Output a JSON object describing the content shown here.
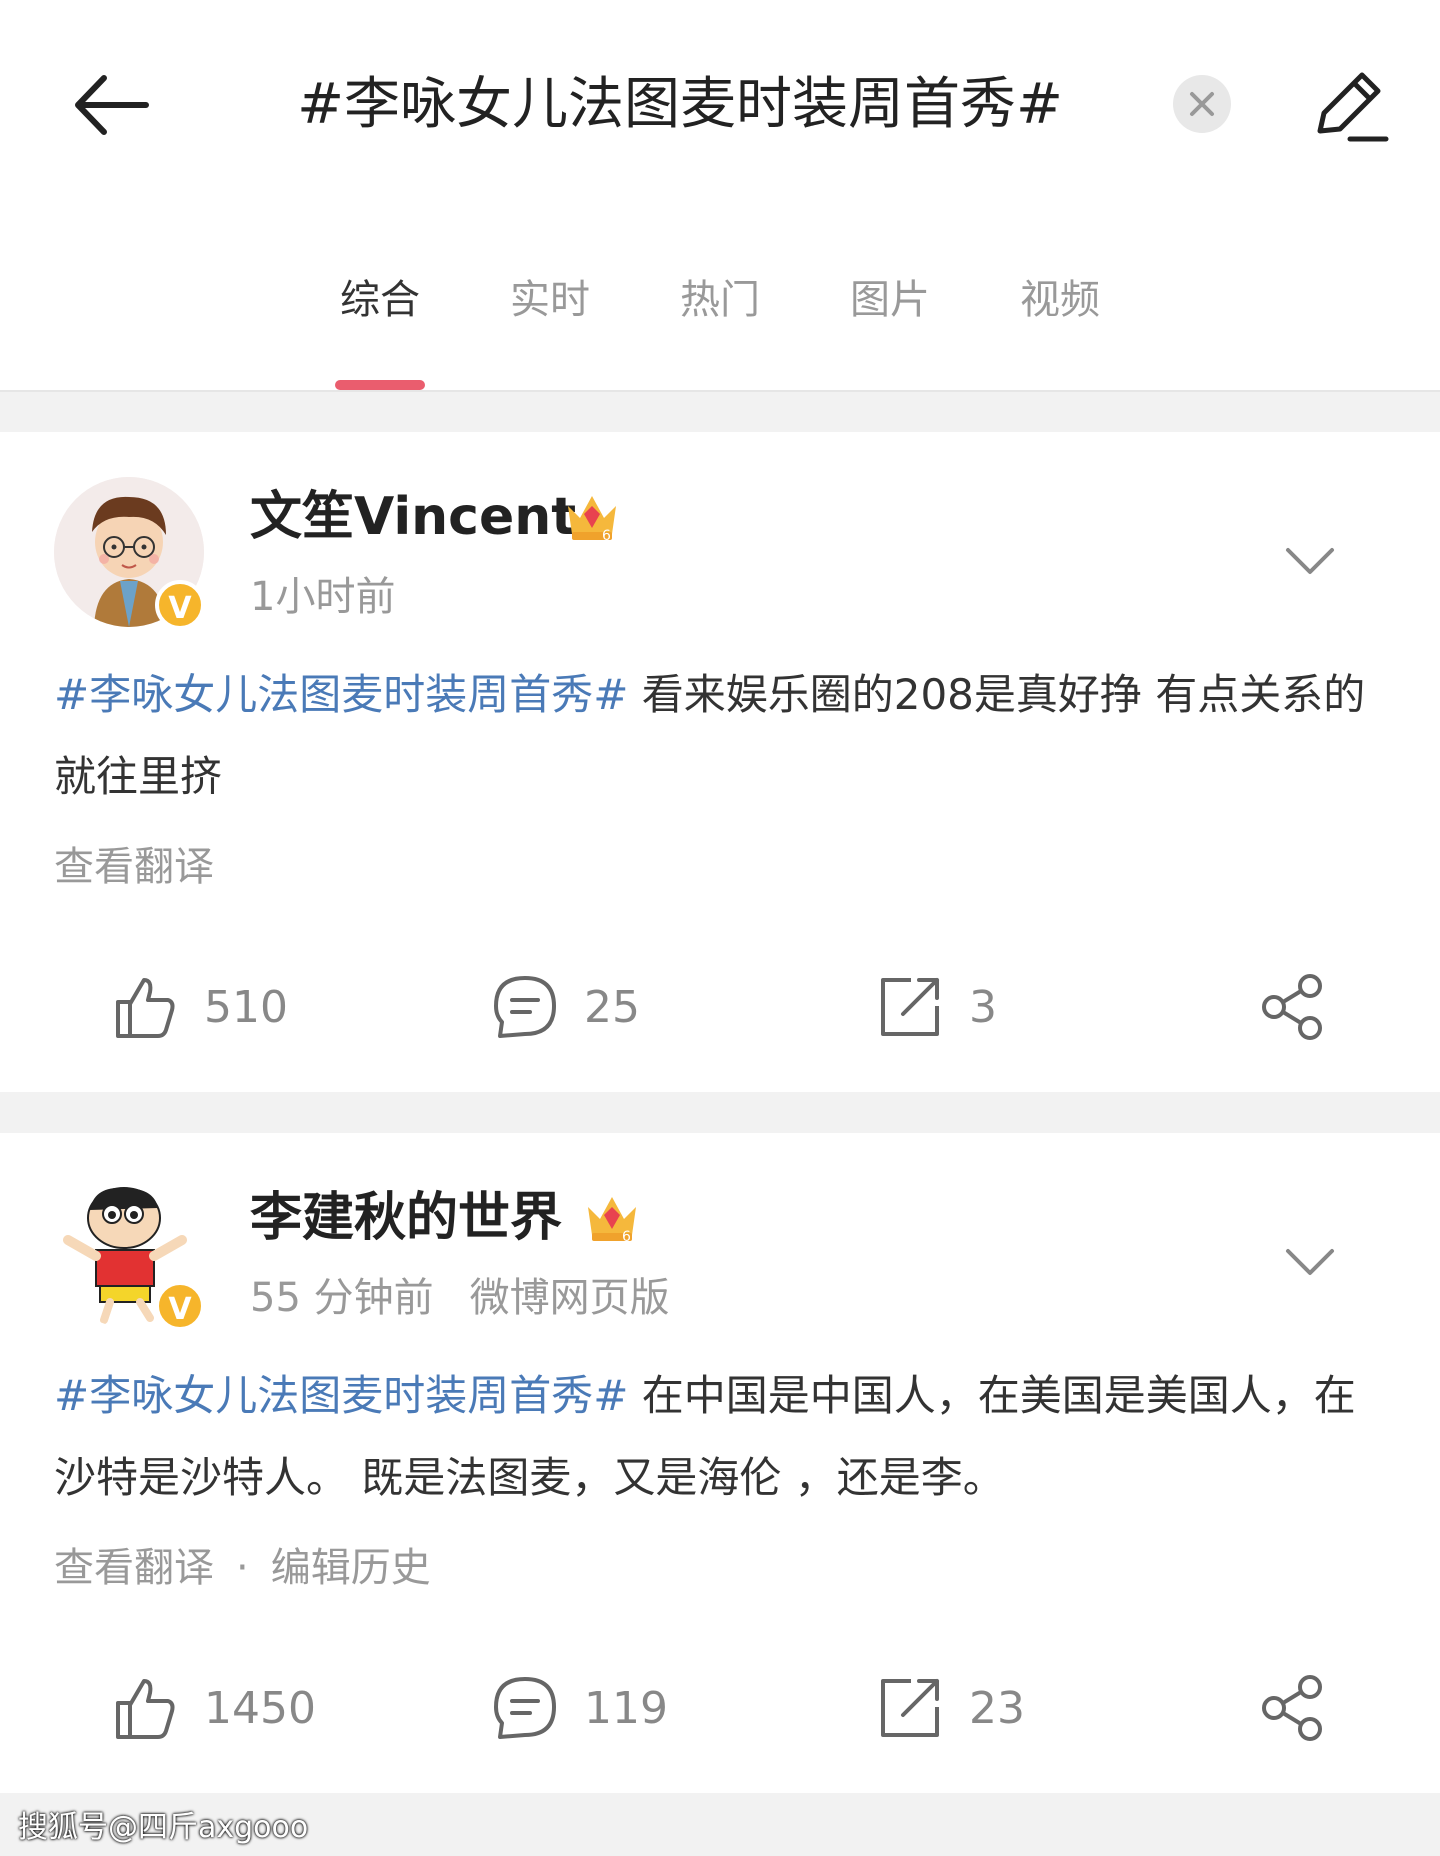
{
  "header": {
    "title": "#李咏女儿法图麦时装周首秀#",
    "back_icon": "arrow-left-icon",
    "clear_icon": "close-icon",
    "edit_icon": "pencil-icon"
  },
  "tabs": [
    {
      "label": "综合",
      "active": true
    },
    {
      "label": "实时",
      "active": false
    },
    {
      "label": "热门",
      "active": false
    },
    {
      "label": "图片",
      "active": false
    },
    {
      "label": "视频",
      "active": false
    }
  ],
  "accent_color": "#ea5d6e",
  "hashtag_color": "#4a7ab7",
  "posts": [
    {
      "username": "文笙Vincent",
      "time": "1小时前",
      "source": "",
      "hashtag": "#李咏女儿法图麦时装周首秀#",
      "text": " 看来娱乐圈的208是真好挣 有点关系的就往里挤",
      "translate": "查看翻译",
      "history": "",
      "likes": "510",
      "comments": "25",
      "reposts": "3"
    },
    {
      "username": "李建秋的世界",
      "time": "55 分钟前",
      "source": "微博网页版",
      "hashtag": "#李咏女儿法图麦时装周首秀#",
      "text": " 在中国是中国人，在美国是美国人，在沙特是沙特人。 既是法图麦，又是海伦 ，还是李。",
      "translate": "查看翻译",
      "dot": "·",
      "history": "编辑历史",
      "likes": "1450",
      "comments": "119",
      "reposts": "23"
    }
  ],
  "watermark": "搜狐号@四斤axgooo"
}
